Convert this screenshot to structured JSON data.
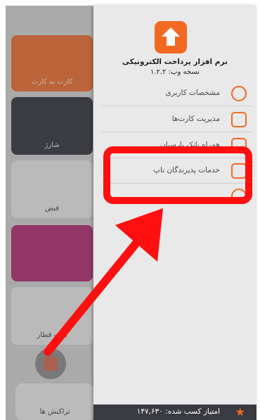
{
  "background": {
    "tiles": [
      {
        "label": "کارت به کارت"
      },
      {
        "label": "شارژ"
      },
      {
        "label": "قبض"
      },
      {
        "label": "بلیت قطار"
      },
      {
        "label": "تراکنش ها"
      }
    ]
  },
  "drawer": {
    "app_title": "نرم افزار پرداخت الکترونیکی",
    "version": "نسخه وب: ۱.۲.۲",
    "items": [
      {
        "label": "مشخصات کاربری",
        "icon": "user-icon"
      },
      {
        "label": "مدیریت کارت‌ها",
        "icon": "cards-icon"
      },
      {
        "label": "همراه بانک پارسیان",
        "icon": "bank-icon"
      },
      {
        "label": "خدمات پذیرندگان تاپ",
        "icon": "calculator-icon"
      },
      {
        "label": "",
        "icon": "info-icon"
      }
    ],
    "footer": {
      "label": "امتیاز کسب شده: ۱۴۷,۶۳۰",
      "icon": "star-icon"
    }
  },
  "colors": {
    "accent": "#f26a22",
    "highlight": "#ff1010",
    "footer_bg": "#3a3b40"
  }
}
